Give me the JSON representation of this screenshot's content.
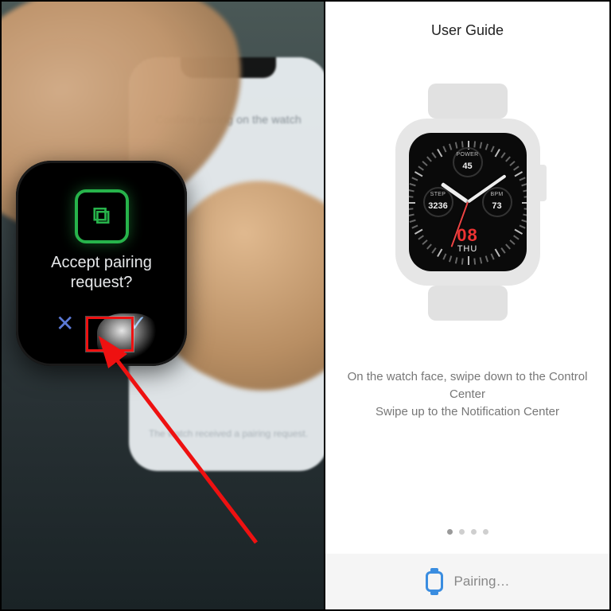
{
  "left": {
    "phone_overlay_title": "Confirm pairing on the watch",
    "phone_overlay_sub": "The watch received a pairing request.",
    "watch_prompt_line1": "Accept pairing",
    "watch_prompt_line2": "request?",
    "cancel_glyph": "✕",
    "confirm_glyph": "✓",
    "pair_icon_glyph": "⧉"
  },
  "right": {
    "title": "User Guide",
    "face": {
      "top_sub_label": "POWER",
      "top_sub_value": "45",
      "left_sub_label": "STEP",
      "left_sub_value": "3236",
      "right_sub_label": "BPM",
      "right_sub_value": "73",
      "date_num": "08",
      "date_day": "THU"
    },
    "copy_line1": "On the watch face, swipe down to the Control Center",
    "copy_line2": "Swipe up to the Notification Center",
    "page_indicator": {
      "count": 4,
      "active": 0
    },
    "status_text": "Pairing…"
  }
}
